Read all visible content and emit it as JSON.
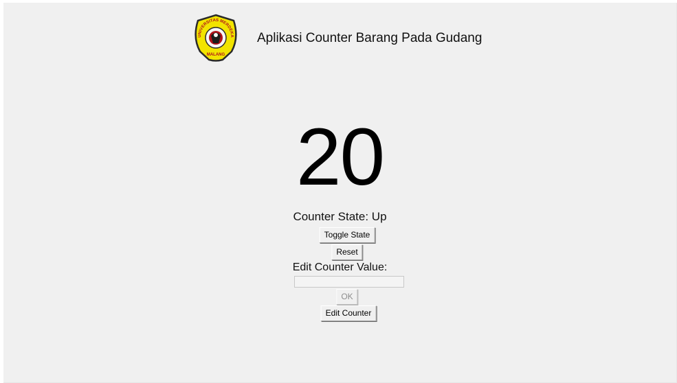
{
  "app": {
    "title": "Aplikasi Counter Barang Pada Gudang",
    "logo": {
      "name": "universitas-merdeka-malang-logo",
      "top_text": "UNIVERSITAS MERDEKA",
      "bottom_text": "MALANG",
      "colors": {
        "shield": "#f2e400",
        "outline": "#2a2a2a",
        "emblem": "#b0121b"
      }
    }
  },
  "counter": {
    "value": "20",
    "state_text": "Counter State: Up"
  },
  "controls": {
    "toggle_label": "Toggle State",
    "reset_label": "Reset",
    "edit_label": "Edit Counter Value:",
    "edit_value": "",
    "ok_label": "OK",
    "edit_counter_label": "Edit Counter"
  }
}
